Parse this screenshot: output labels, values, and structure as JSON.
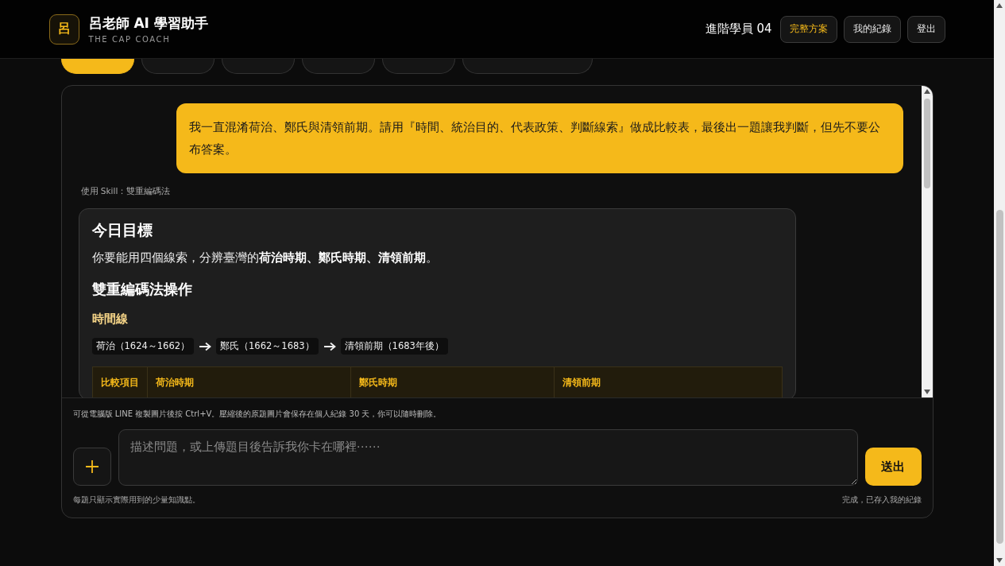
{
  "header": {
    "logo_mark": "呂",
    "title": "呂老師 AI 學習助手",
    "subtitle": "THE CAP COACH",
    "user": "進階學員 04",
    "buttons": [
      {
        "label": "完整方案",
        "kind": "highlight"
      },
      {
        "label": "我的紀錄",
        "kind": "plain"
      },
      {
        "label": "登出",
        "kind": "plain"
      }
    ]
  },
  "tabs": [
    {
      "selected": true
    },
    {
      "selected": false
    },
    {
      "selected": false
    },
    {
      "selected": false
    },
    {
      "selected": false
    },
    {
      "selected": false
    }
  ],
  "chat": {
    "user_message": "我一直混淆荷治、鄭氏與清領前期。請用『時間、統治目的、代表政策、判斷線索』做成比較表，最後出一題讓我判斷，但先不要公布答案。",
    "skill_label": "使用 Skill：雙重編碼法",
    "answer": {
      "goal_heading": "今日目標",
      "goal_text": "你要能用四個線索，分辨臺灣的**荷治時期、鄭氏時期、清領前期**。",
      "method_heading": "雙重編碼法操作",
      "timeline_heading": "時間線",
      "timeline": [
        "荷治（1624～1662）",
        "鄭氏（1662～1683）",
        "清領前期（1683年後）"
      ],
      "table": {
        "columns": [
          "比較項目",
          "荷治時期",
          "鄭氏時期",
          "清領前期"
        ]
      }
    }
  },
  "composer": {
    "hint": "可從電腦版 LINE 複製圖片後按 Ctrl+V。壓縮後的原題圖片會保存在個人紀錄 30 天，你可以隨時刪除。",
    "placeholder": "描述問題，或上傳題目後告訴我你卡在哪裡⋯⋯",
    "send_label": "送出",
    "note_left": "每題只顯示實際用到的少量知識點。",
    "note_right": "完成，已存入我的紀錄"
  }
}
